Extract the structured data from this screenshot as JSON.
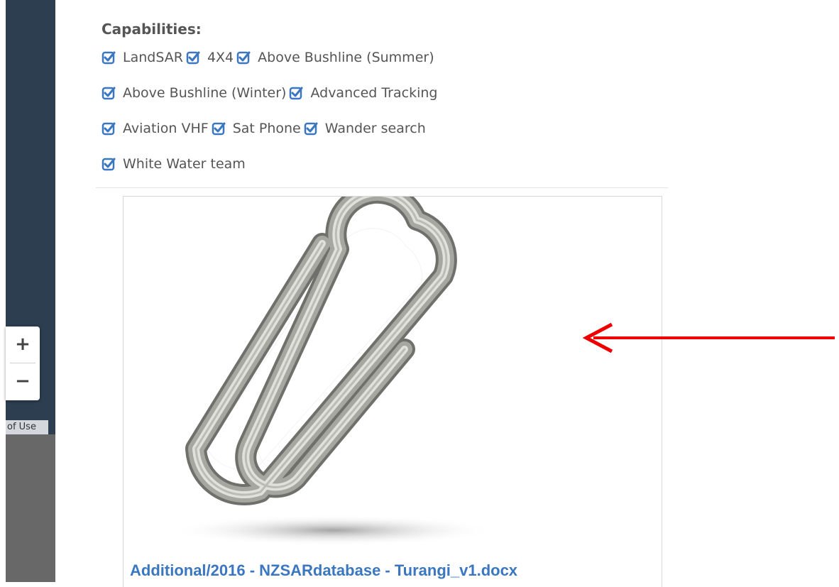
{
  "map": {
    "zoom_in_label": "+",
    "zoom_out_label": "−",
    "terms_label": "of Use"
  },
  "capabilities": {
    "title": "Capabilities:",
    "checked_icon": "check-square-icon",
    "rows": [
      [
        "LandSAR",
        "4X4",
        "Above Bushline (Summer)"
      ],
      [
        "Above Bushline (Winter)",
        "Advanced Tracking"
      ],
      [
        "Aviation VHF",
        "Sat Phone",
        "Wander search"
      ],
      [
        "White Water team"
      ]
    ]
  },
  "attachment": {
    "icon": "paperclip-icon",
    "link_text": "Additional/2016 - NZSARdatabase - Turangi_v1.docx"
  },
  "annotation": {
    "icon": "red-arrow-icon",
    "color": "#ee0000"
  },
  "colors": {
    "map_panel": "#2c3e50",
    "checkbox": "#3a77c0",
    "link": "#3a77c0",
    "text": "#555555"
  }
}
